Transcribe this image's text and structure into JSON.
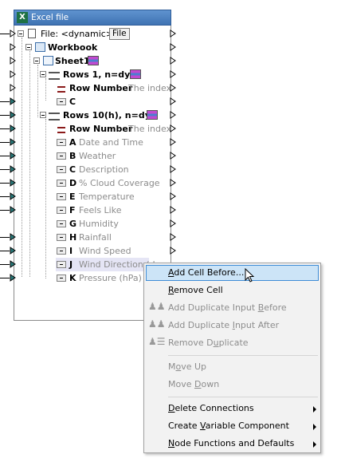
{
  "component": {
    "title": "Excel file",
    "file_row": {
      "label": "File: <dynamic>",
      "button": "File"
    },
    "workbook": "Workbook",
    "sheet": "Sheet1",
    "rows1": {
      "label": "Rows 1, n=dyn",
      "row_number": "Row Number",
      "row_number_hint": "The index",
      "col": "C"
    },
    "rows10": {
      "label": "Rows 10(h), n=dyn",
      "row_number": "Row Number",
      "row_number_hint": "The index"
    },
    "columns": [
      {
        "letter": "A",
        "name": "Date and Time"
      },
      {
        "letter": "B",
        "name": "Weather"
      },
      {
        "letter": "C",
        "name": "Description"
      },
      {
        "letter": "D",
        "name": "% Cloud Coverage"
      },
      {
        "letter": "E",
        "name": "Temperature"
      },
      {
        "letter": "F",
        "name": "Feels Like"
      },
      {
        "letter": "G",
        "name": "Humidity"
      },
      {
        "letter": "H",
        "name": "Rainfall"
      },
      {
        "letter": "I",
        "name": "Wind Speed"
      },
      {
        "letter": "J",
        "name": "Wind Direction (d"
      },
      {
        "letter": "K",
        "name": "Pressure (hPa)"
      }
    ]
  },
  "context_menu": {
    "items": [
      {
        "pre": "",
        "u": "A",
        "post": "dd Cell Before...",
        "enabled": true,
        "highlighted": true
      },
      {
        "pre": "",
        "u": "R",
        "post": "emove Cell",
        "enabled": true
      },
      {
        "pre": "Add Duplicate Input ",
        "u": "B",
        "post": "efore",
        "enabled": false
      },
      {
        "pre": "Add Duplicate ",
        "u": "I",
        "post": "nput After",
        "enabled": false
      },
      {
        "pre": "Remove D",
        "u": "u",
        "post": "plicate",
        "enabled": false
      },
      {
        "pre": "M",
        "u": "o",
        "post": "ve Up",
        "enabled": false
      },
      {
        "pre": "Move ",
        "u": "D",
        "post": "own",
        "enabled": false
      },
      {
        "pre": "",
        "u": "D",
        "post": "elete Connections",
        "enabled": true
      },
      {
        "pre": "Create ",
        "u": "V",
        "post": "ariable Component",
        "enabled": true
      },
      {
        "pre": "",
        "u": "N",
        "post": "ode Functions and Defaults",
        "enabled": true
      }
    ]
  },
  "colors": {
    "title_bar": "#4a7fc1",
    "highlight": "#cce4f7",
    "highlight_border": "#3f8dd6",
    "connector": "#2a7a7a"
  }
}
